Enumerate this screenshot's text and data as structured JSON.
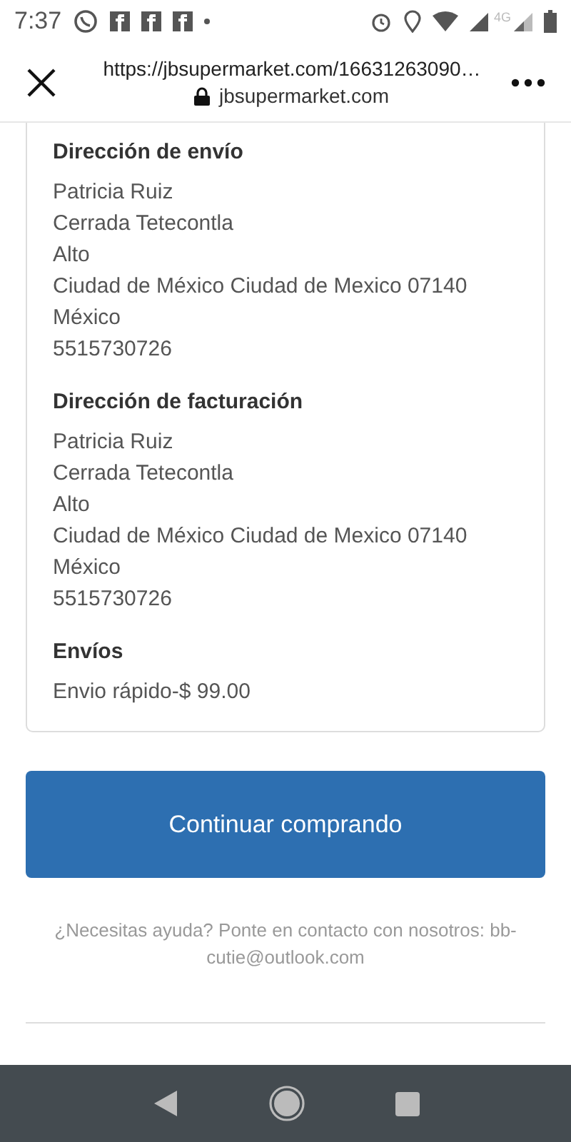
{
  "status_bar": {
    "time": "7:37",
    "network": "4G"
  },
  "browser_bar": {
    "url": "https://jbsupermarket.com/16631263090…",
    "domain": "jbsupermarket.com"
  },
  "sections": [
    {
      "title": "Dirección de envío",
      "lines": [
        "Patricia Ruiz",
        "Cerrada Tetecontla",
        "Alto",
        "Ciudad de México Ciudad de Mexico 07140",
        "México",
        "5515730726"
      ]
    },
    {
      "title": "Dirección de facturación",
      "lines": [
        "Patricia Ruiz",
        "Cerrada Tetecontla",
        "Alto",
        "Ciudad de México Ciudad de Mexico 07140",
        "México",
        "5515730726"
      ]
    },
    {
      "title": "Envíos",
      "lines": [
        "Envio rápido-$ 99.00"
      ]
    }
  ],
  "continue_button": "Continuar comprando",
  "help_text": "¿Necesitas ayuda? Ponte en contacto con nosotros: bb-cutie@outlook.com"
}
